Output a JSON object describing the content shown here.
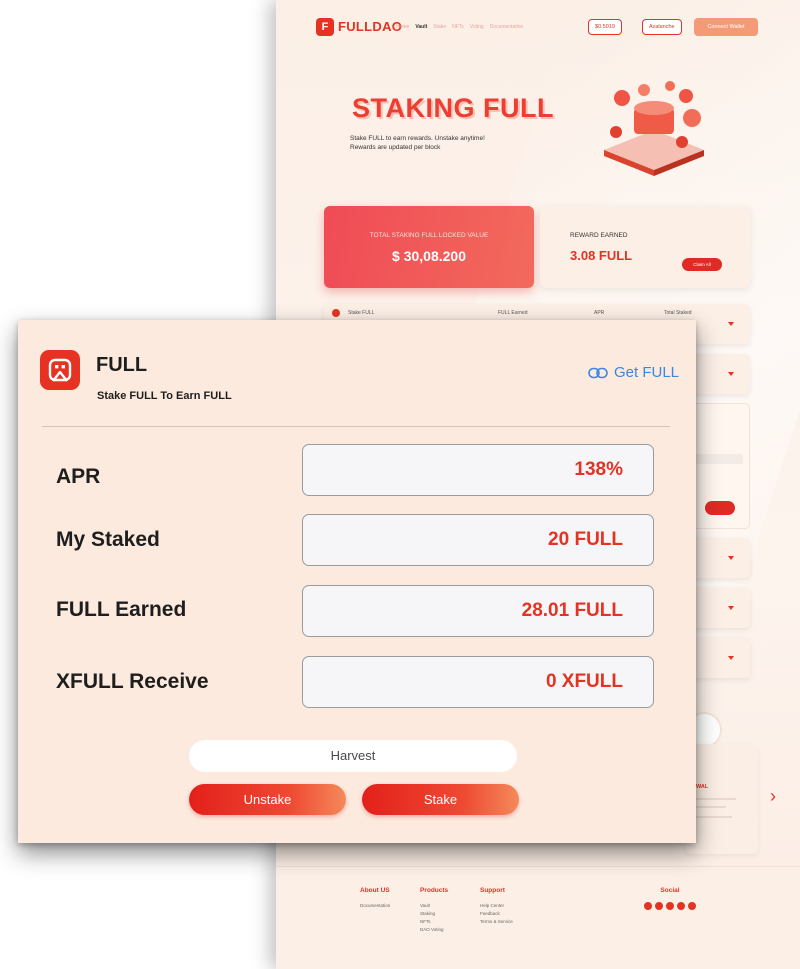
{
  "site": {
    "brand": "FULLDAO",
    "nav": [
      "Home",
      "Vault",
      "Stake",
      "NFTs",
      "Voting",
      "Documentation"
    ],
    "nav_active": "Vault",
    "price": "$0.5019",
    "chain": "Avalanche",
    "connect": "Connect Wallet",
    "hero_title": "STAKING FULL",
    "hero_sub_1": "Stake FULL to earn rewards. Unstake anytime!",
    "hero_sub_2": "Rewards are updated per block",
    "tvl_label": "TOTAL STAKING FULL LOCKED VALUE",
    "tvl_value": "$ 30,08.200",
    "reward_label": "REWARD EARNED",
    "reward_value": "3.08 FULL",
    "claim": "Claim All",
    "pool_head": {
      "name": "Stake FULL",
      "earned": "FULL Earned",
      "apr": "APR",
      "total": "Total Staked"
    },
    "withdraw_title": "WAL",
    "footer": {
      "about_head": "About US",
      "about_items": [
        "Documentation"
      ],
      "products_head": "Products",
      "products_items": [
        "Vault",
        "Staking",
        "NFTs",
        "DAO Voting"
      ],
      "support_head": "Support",
      "support_items": [
        "Help Center",
        "Feedback",
        "Terms & Service"
      ],
      "social_head": "Social"
    }
  },
  "modal": {
    "token_name": "FULL",
    "token_sub": "Stake FULL To Earn FULL",
    "get_link": "Get FULL",
    "rows": [
      {
        "label": "APR",
        "value": "138%"
      },
      {
        "label": "My Staked",
        "value": "20 FULL"
      },
      {
        "label": "FULL Earned",
        "value": "28.01 FULL"
      },
      {
        "label": "XFULL Receive",
        "value": "0 XFULL"
      }
    ],
    "harvest": "Harvest",
    "unstake": "Unstake",
    "stake": "Stake"
  },
  "colors": {
    "accent": "#e53222",
    "link": "#3a86e0",
    "modal_bg": "#fdeadf"
  }
}
